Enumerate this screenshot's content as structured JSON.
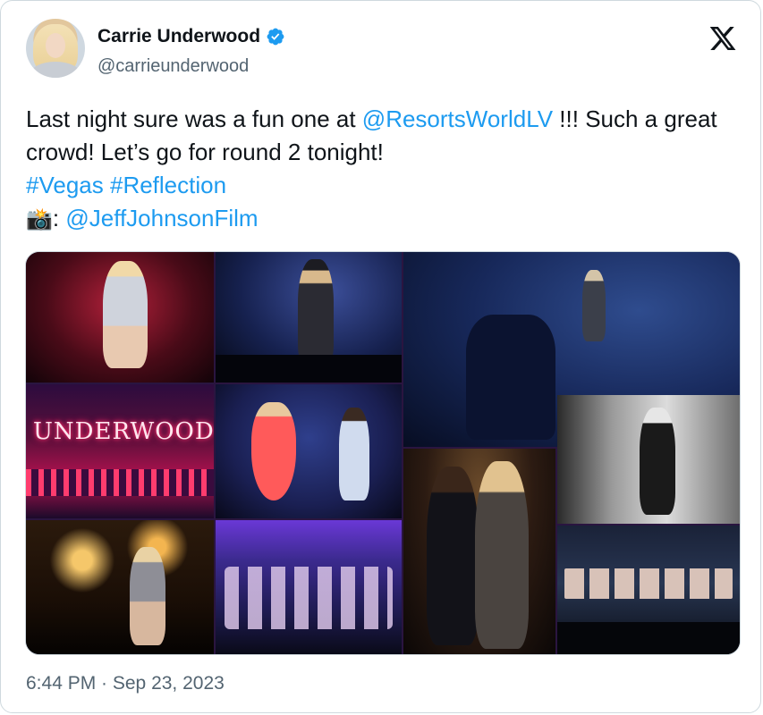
{
  "author": {
    "display_name": "Carrie Underwood",
    "handle": "@carrieunderwood",
    "verified": true
  },
  "tweet": {
    "line1_prefix": "Last night sure was a fun one at ",
    "mention1": "@ResortsWorldLV",
    "line1_suffix": " !!! Such a great crowd! Let’s go for round 2 tonight!",
    "hashtag1": "#Vegas",
    "hashtag2": "#Reflection",
    "camera_emoji": "📸",
    "colon": ": ",
    "mention2": "@JeffJohnsonFilm"
  },
  "media": {
    "sign_text": "UNDERWOOD"
  },
  "timestamp": "6:44 PM · Sep 23, 2023",
  "colors": {
    "link": "#1d9bf0",
    "text": "#0f1419",
    "secondary": "#536471",
    "border": "#cfd9de"
  },
  "icons": {
    "brand": "x-logo-icon",
    "verified": "verified-badge-icon"
  }
}
